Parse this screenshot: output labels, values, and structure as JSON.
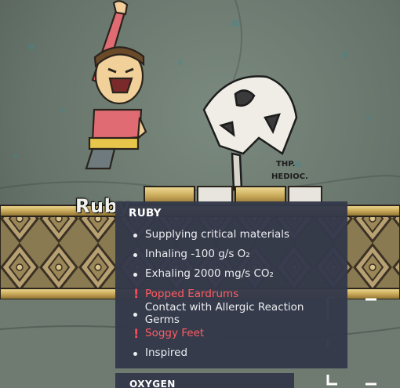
{
  "nameplate": {
    "text": "Ruby"
  },
  "tooltip": {
    "title": "RUBY",
    "items": [
      {
        "kind": "bullet",
        "text": "Supplying critical materials"
      },
      {
        "kind": "bullet",
        "text": "Inhaling -100 g/s O₂"
      },
      {
        "kind": "bullet",
        "text": "Exhaling 2000 mg/s CO₂"
      },
      {
        "kind": "warning",
        "text": "Popped Eardrums",
        "color": "#ff5c63"
      },
      {
        "kind": "bullet",
        "text": "Contact with Allergic Reaction Germs"
      },
      {
        "kind": "warning",
        "text": "Soggy Feet",
        "color": "#ff5c63"
      },
      {
        "kind": "bullet",
        "text": "Inspired"
      }
    ]
  },
  "tooltip_next": {
    "title": "OXYGEN"
  },
  "colors": {
    "tooltip_bg": "#34394a",
    "warning": "#ff4a55",
    "cave_bg": "#5f6b62",
    "brass": "#c9a95a"
  },
  "icons": [
    "warning-icon",
    "bullet-dot",
    "selection-bracket"
  ]
}
